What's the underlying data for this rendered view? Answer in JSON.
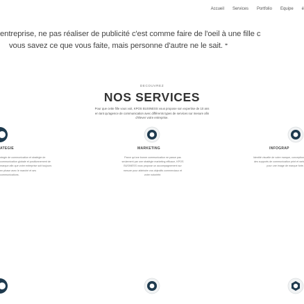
{
  "nav": {
    "items": [
      "Accueil",
      "Services",
      "Portfolio",
      "Equipe",
      "é"
    ]
  },
  "quote": {
    "line1": "entreprise, ne pas réaliser de publicité c'est comme faire de l'oeil à une fille c",
    "line2": "vous savez ce que vous faite, mais personne d'autre ne le sait.",
    "mark": "”"
  },
  "services": {
    "eyebrow": "DECOUVREZ",
    "title": "NOS SERVICES",
    "intro": "Pour que cette fille vous voit, KPOS BUSINESS vous propose son expertise de 10 ans en tant qu'agence de communication avec différents types de services sur mesure afin d'élever votre entreprise.",
    "columns": [
      {
        "label": "ATEGIE",
        "description": "ntegie de communication et stratégie de communication globale et positionnement de marque afin que votre entreprise soit toujours en phase avec le marché et ses communications."
      },
      {
        "label": "MARKETING",
        "description": "Parce qu'une bonne communication ne passe pas seulement par une stratégie marketing efficace, KPOS BUSINESS vous propose un accompagnement sur mesure pour atteindre vos objectifs commerciaux et votre notoriété."
      },
      {
        "label": "INFOGRAP",
        "description": "Identité visuelle de votre marque, conception des supports de communication print et web pour une image de marque forte."
      }
    ]
  },
  "colors": {
    "dark_icon": "#1e3a4e",
    "text": "#444444",
    "accent": "#2a4458"
  },
  "icons": [
    "partial-dark-icon",
    "circle-chat-icon",
    "circle-badge-icon",
    "partial-dark-icon",
    "circle-target-icon",
    "circle-hexagon-icon"
  ]
}
